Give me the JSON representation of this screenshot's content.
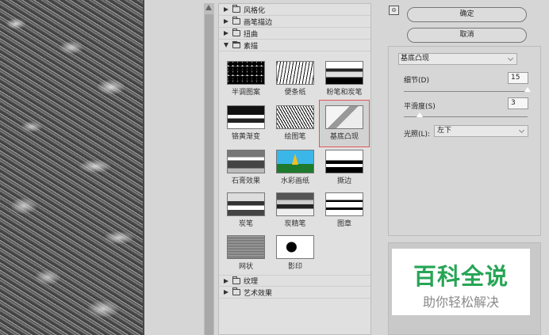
{
  "gallery": {
    "categories_top": [
      {
        "label": "风格化",
        "expanded": false
      },
      {
        "label": "画笔描边",
        "expanded": false
      },
      {
        "label": "扭曲",
        "expanded": false
      },
      {
        "label": "素描",
        "expanded": true
      }
    ],
    "thumbnails": [
      {
        "label": "半调图案",
        "icon": "halftone-thumb"
      },
      {
        "label": "便条纸",
        "icon": "note-paper-thumb"
      },
      {
        "label": "粉笔和炭笔",
        "icon": "chalk-charcoal-thumb"
      },
      {
        "label": "铬黄渐变",
        "icon": "chrome-thumb"
      },
      {
        "label": "绘图笔",
        "icon": "graphic-pen-thumb"
      },
      {
        "label": "基底凸现",
        "icon": "bas-relief-thumb",
        "selected": true
      },
      {
        "label": "石膏效果",
        "icon": "plaster-thumb"
      },
      {
        "label": "水彩画纸",
        "icon": "water-paper-thumb"
      },
      {
        "label": "撕边",
        "icon": "torn-edges-thumb"
      },
      {
        "label": "炭笔",
        "icon": "charcoal-thumb"
      },
      {
        "label": "炭精笔",
        "icon": "conte-crayon-thumb"
      },
      {
        "label": "图章",
        "icon": "stamp-thumb"
      },
      {
        "label": "网状",
        "icon": "reticulation-thumb"
      },
      {
        "label": "影印",
        "icon": "photocopy-thumb"
      }
    ],
    "categories_bottom": [
      {
        "label": "纹理",
        "expanded": false
      },
      {
        "label": "艺术效果",
        "expanded": false
      }
    ]
  },
  "actions": {
    "collapse_glyph": "≎",
    "ok_label": "确定",
    "cancel_label": "取消"
  },
  "settings": {
    "filter_name": "基底凸现",
    "detail_label": "细节(D)",
    "detail_value": "15",
    "detail_fraction": 1.0,
    "smoothness_label": "平滑度(S)",
    "smoothness_value": "3",
    "smoothness_fraction": 0.13,
    "light_label": "光照(L):",
    "light_value": "左下"
  },
  "watermark": {
    "title": "百科全说",
    "subtitle": "助你轻松解决",
    "title_color": "#27a556"
  },
  "colors": {
    "selection_border": "#e25555"
  }
}
